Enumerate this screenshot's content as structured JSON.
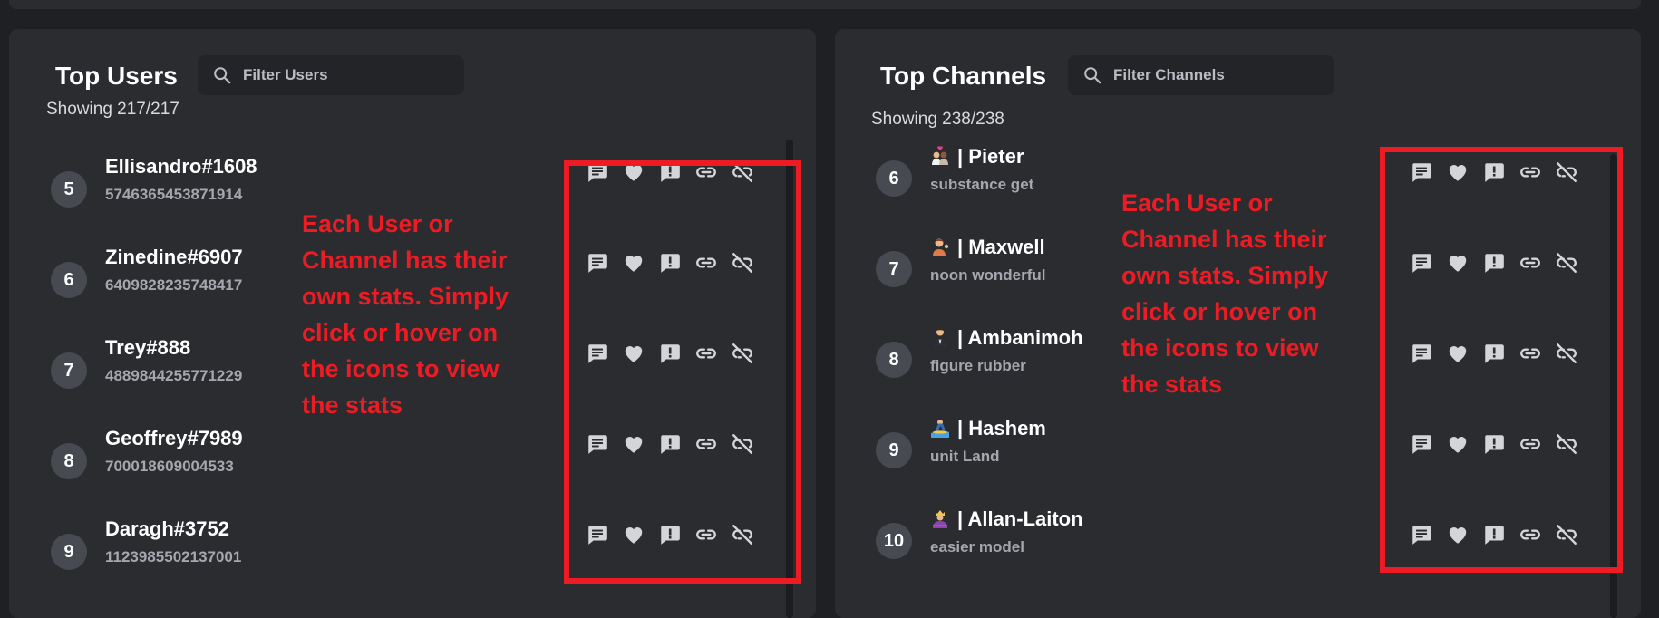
{
  "users_panel": {
    "title": "Top Users",
    "filter_placeholder": "Filter Users",
    "showing": "Showing 217/217",
    "rows": [
      {
        "rank": "5",
        "name": "Ellisandro#1608",
        "sub": "5746365453871914"
      },
      {
        "rank": "6",
        "name": "Zinedine#6907",
        "sub": "6409828235748417"
      },
      {
        "rank": "7",
        "name": "Trey#888",
        "sub": "4889844255771229"
      },
      {
        "rank": "8",
        "name": "Geoffrey#7989",
        "sub": "700018609004533"
      },
      {
        "rank": "9",
        "name": "Daragh#3752",
        "sub": "1123985502137001"
      }
    ],
    "annotation": "Each User or Channel has their own stats. Simply click or hover on the icons to view the stats"
  },
  "channels_panel": {
    "title": "Top Channels",
    "filter_placeholder": "Filter Channels",
    "showing": "Showing 238/238",
    "rows": [
      {
        "rank": "6",
        "name": "| Pieter",
        "sub": "substance get",
        "emoji": "couple-heart-emoji"
      },
      {
        "rank": "7",
        "name": "| Maxwell",
        "sub": "noon wonderful",
        "emoji": "person-tipping-hand-emoji"
      },
      {
        "rank": "8",
        "name": "| Ambanimoh",
        "sub": "figure rubber",
        "emoji": "person-in-tuxedo-emoji"
      },
      {
        "rank": "9",
        "name": "| Hashem",
        "sub": "unit Land",
        "emoji": "surfer-emoji"
      },
      {
        "rank": "10",
        "name": "| Allan-Laiton",
        "sub": "easier model",
        "emoji": "person-with-crown-emoji"
      }
    ],
    "annotation": "Each User or Channel has their own stats. Simply click or hover on the icons to view the stats"
  },
  "stat_icons": [
    "message-icon",
    "heart-icon",
    "report-icon",
    "link-icon",
    "link-off-icon"
  ],
  "colors": {
    "background": "#1f2023",
    "panel": "#2b2c30",
    "rank_badge": "#484a51",
    "annotation_red": "#ed1c24",
    "icon": "#d4d5d8"
  }
}
